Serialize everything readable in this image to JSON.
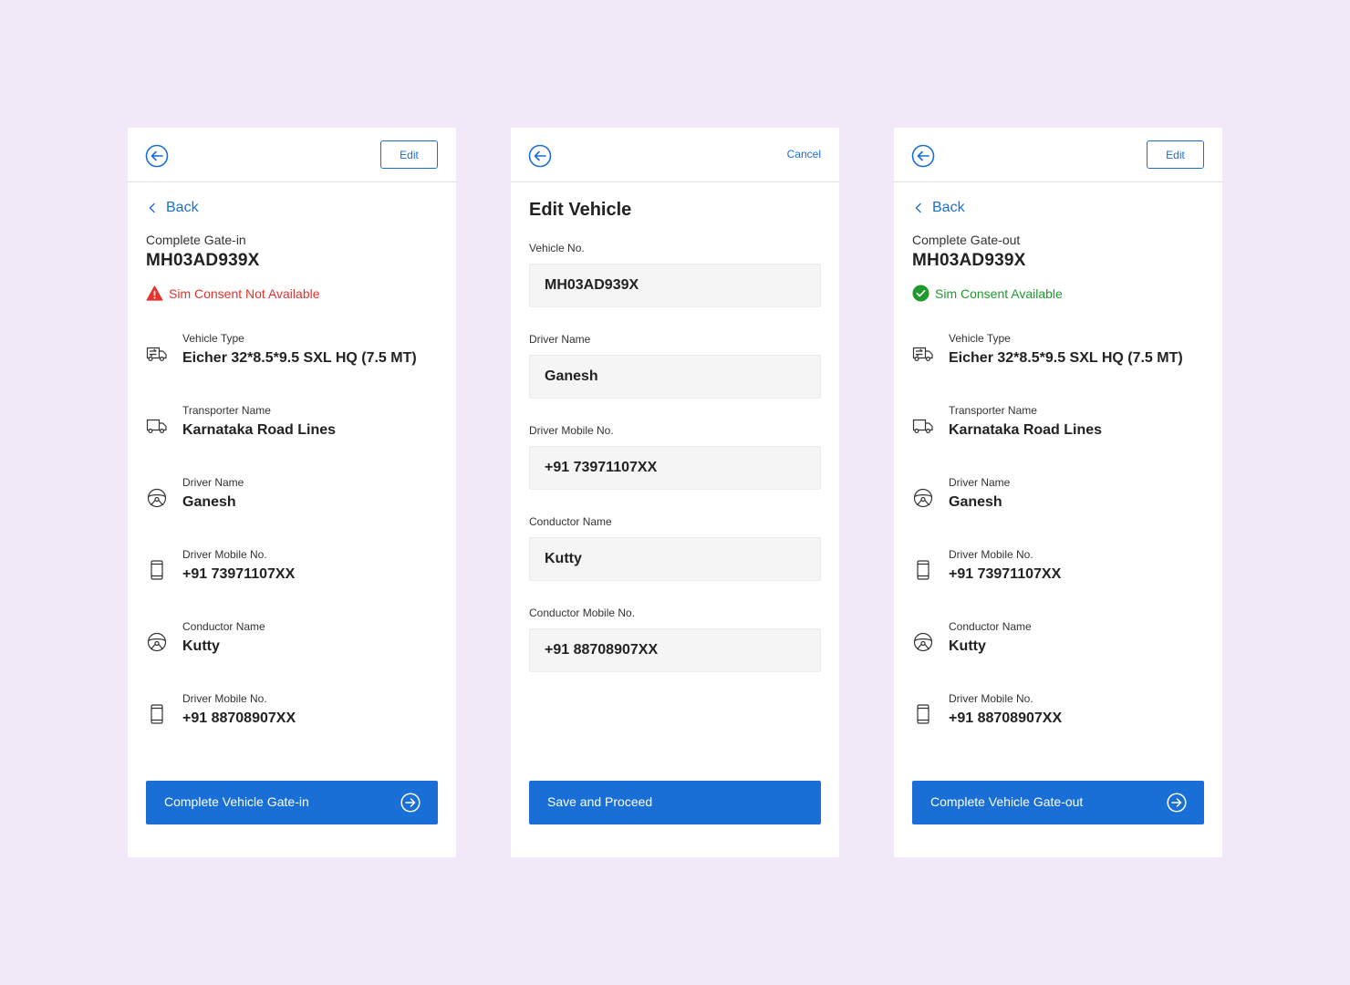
{
  "colors": {
    "background": "#f1e8f8",
    "primary": "#1a6fd6",
    "error": "#e5322d",
    "success": "#1f9a2d"
  },
  "gatein": {
    "edit_label": "Edit",
    "back_label": "Back",
    "subtitle": "Complete Gate-in",
    "vehicle_no": "MH03AD939X",
    "consent_text": "Sim Consent Not Available",
    "details": [
      {
        "icon": "truck-swap-icon",
        "label": "Vehicle Type",
        "value": "Eicher 32*8.5*9.5 SXL HQ (7.5 MT)"
      },
      {
        "icon": "truck-icon",
        "label": "Transporter Name",
        "value": "Karnataka Road Lines"
      },
      {
        "icon": "steering-wheel-icon",
        "label": "Driver Name",
        "value": "Ganesh"
      },
      {
        "icon": "mobile-phone-icon",
        "label": "Driver Mobile No.",
        "value": "+91 73971107XX"
      },
      {
        "icon": "steering-wheel-icon",
        "label": "Conductor Name",
        "value": "Kutty"
      },
      {
        "icon": "mobile-phone-icon",
        "label": "Driver Mobile No.",
        "value": "+91 88708907XX"
      }
    ],
    "button_label": "Complete Vehicle Gate-in"
  },
  "edit": {
    "cancel_label": "Cancel",
    "title": "Edit Vehicle",
    "fields": [
      {
        "label": "Vehicle No.",
        "value": "MH03AD939X"
      },
      {
        "label": "Driver Name",
        "value": "Ganesh"
      },
      {
        "label": "Driver Mobile No.",
        "value": "+91 73971107XX"
      },
      {
        "label": "Conductor Name",
        "value": "Kutty"
      },
      {
        "label": "Conductor Mobile No.",
        "value": "+91 88708907XX"
      }
    ],
    "button_label": "Save and Proceed"
  },
  "gateout": {
    "edit_label": "Edit",
    "back_label": "Back",
    "subtitle": "Complete Gate-out",
    "vehicle_no": "MH03AD939X",
    "consent_text": "Sim Consent Available",
    "details": [
      {
        "icon": "truck-swap-icon",
        "label": "Vehicle Type",
        "value": "Eicher 32*8.5*9.5 SXL HQ (7.5 MT)"
      },
      {
        "icon": "truck-icon",
        "label": "Transporter Name",
        "value": "Karnataka Road Lines"
      },
      {
        "icon": "steering-wheel-icon",
        "label": "Driver Name",
        "value": "Ganesh"
      },
      {
        "icon": "mobile-phone-icon",
        "label": "Driver Mobile No.",
        "value": "+91 73971107XX"
      },
      {
        "icon": "steering-wheel-icon",
        "label": "Conductor Name",
        "value": "Kutty"
      },
      {
        "icon": "mobile-phone-icon",
        "label": "Driver Mobile No.",
        "value": "+91 88708907XX"
      }
    ],
    "button_label": "Complete Vehicle Gate-out"
  }
}
